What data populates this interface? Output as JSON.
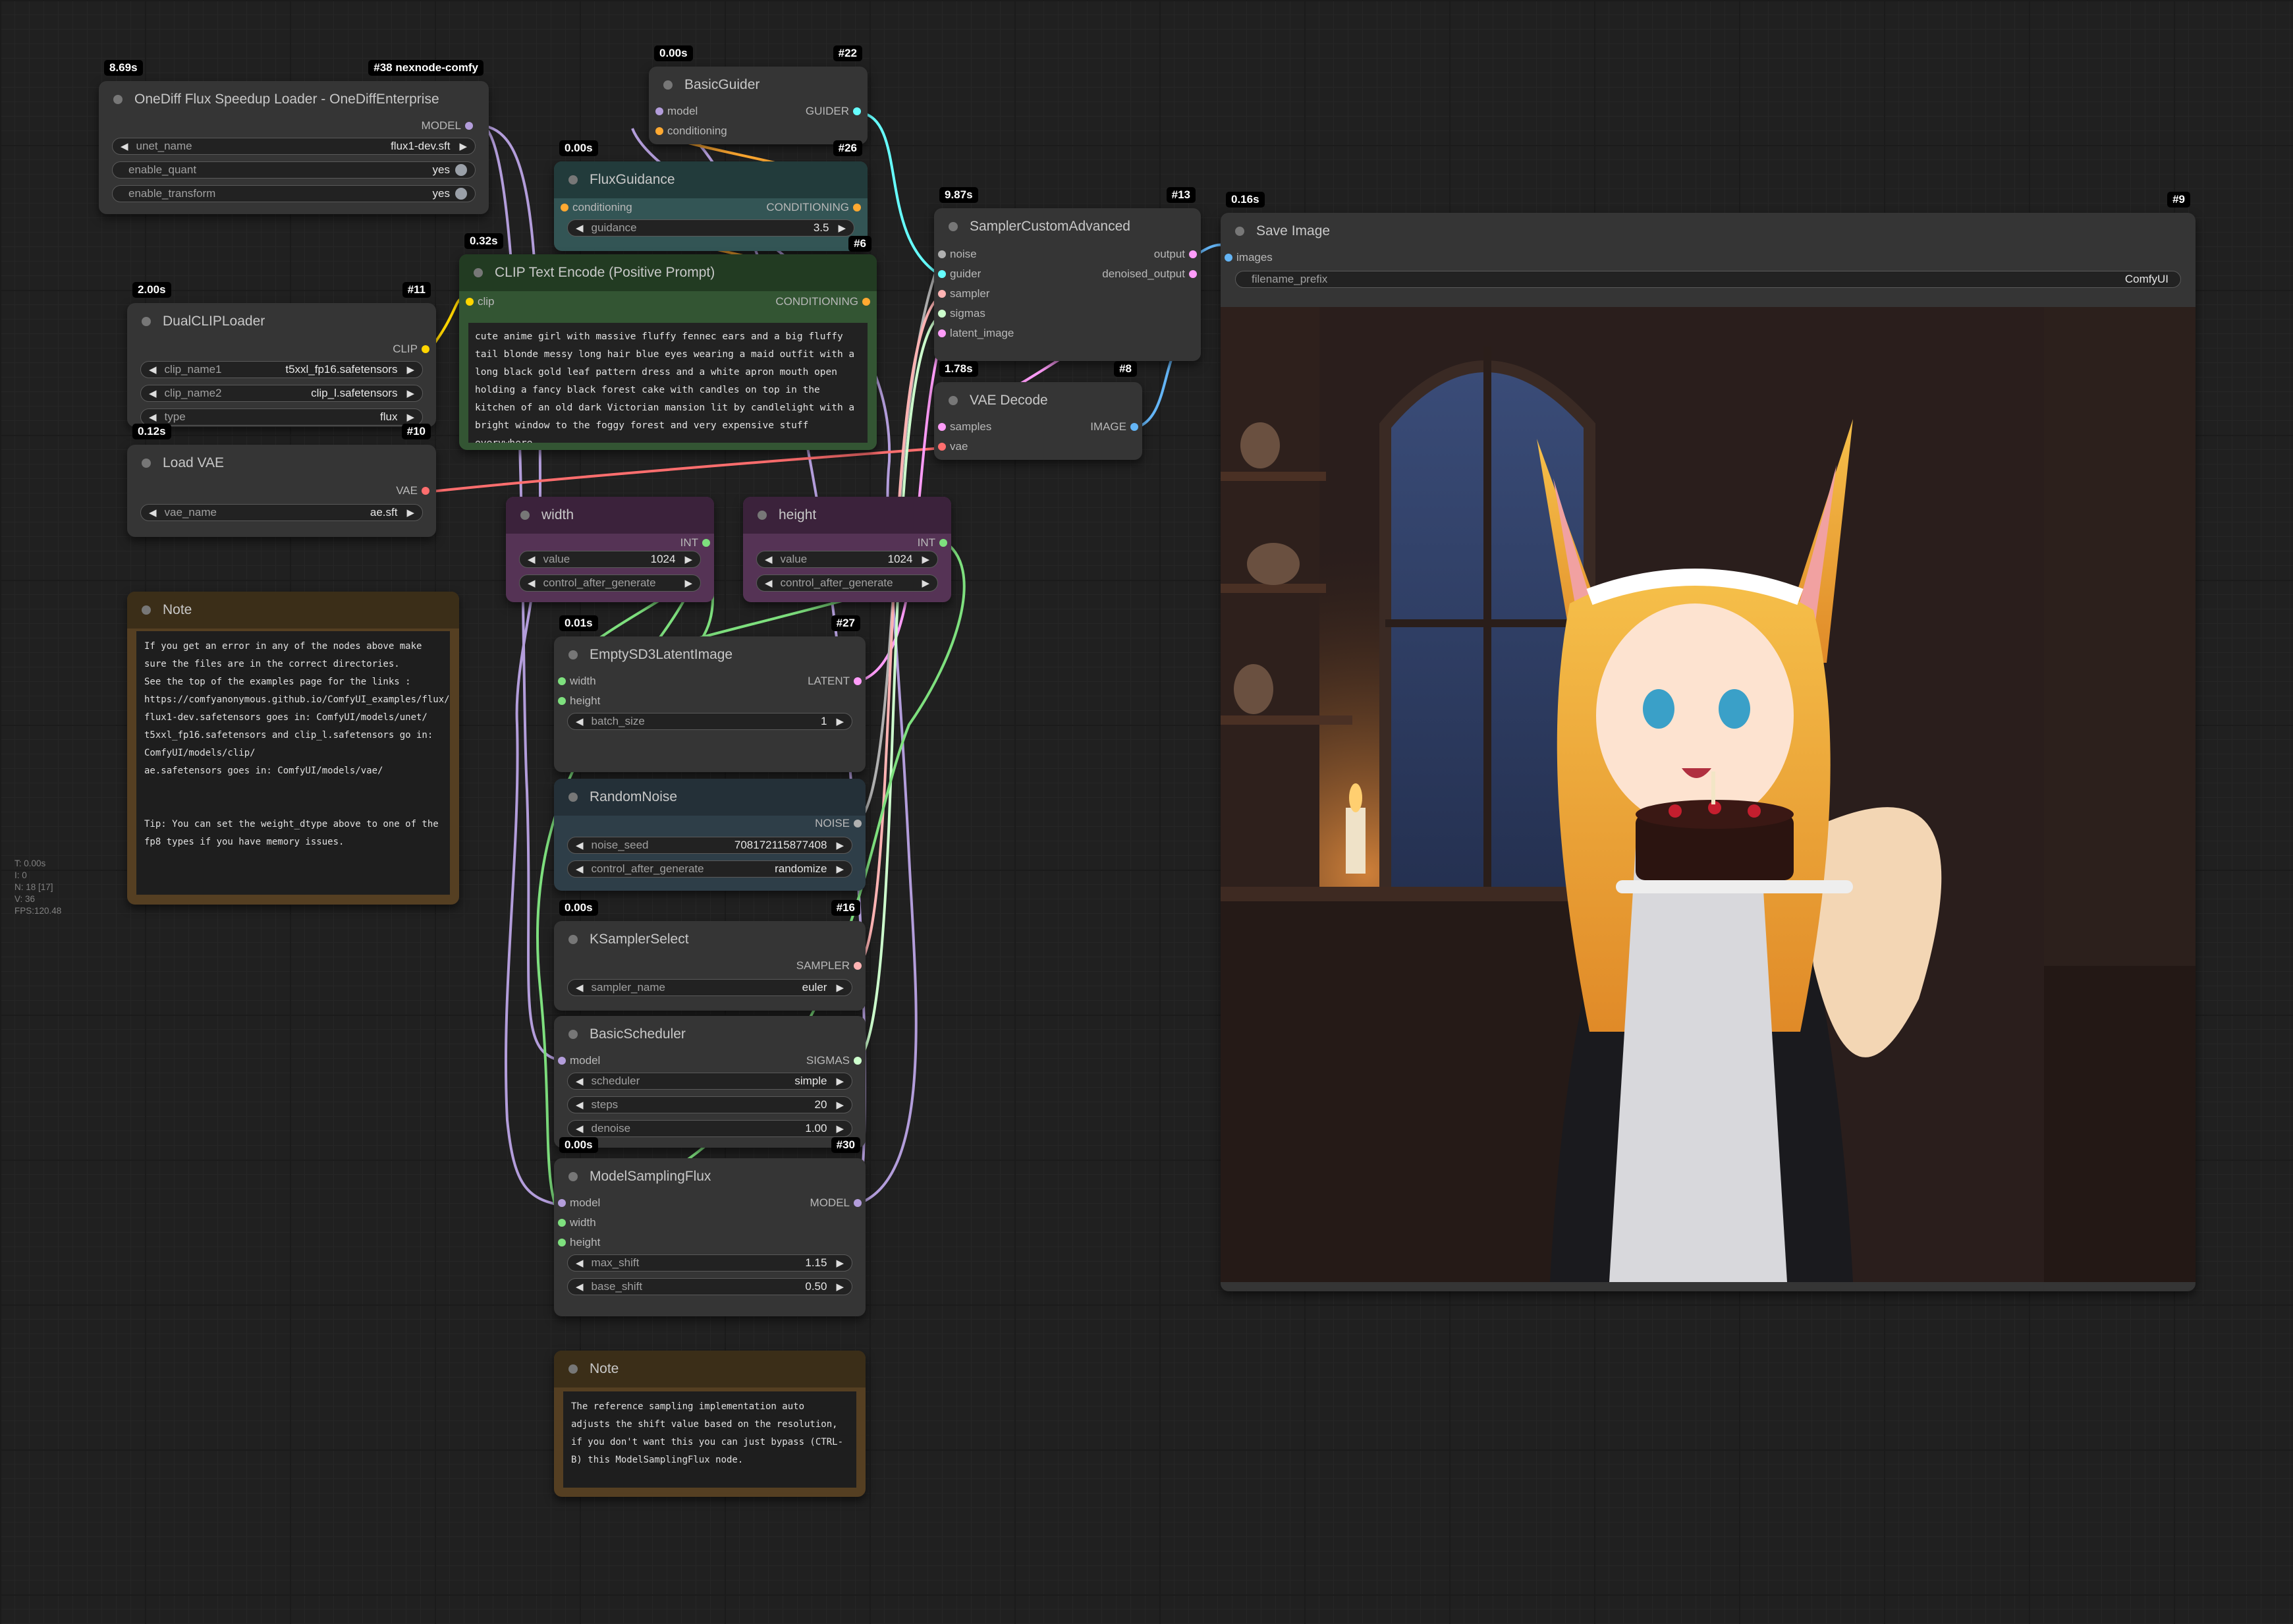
{
  "app": {
    "name": "ComfyUI"
  },
  "colors": {
    "model": "#b39ddb",
    "conditioning": "#ffa931",
    "clip": "#ffd500",
    "vae": "#ff6e6e",
    "latent": "#ff9cf9",
    "image": "#64b5f6",
    "int": "#7ee07e",
    "noise": "#b0b0b0",
    "guider": "#66ffff",
    "sampler": "#ffb3b3",
    "sigmas": "#cdffcd"
  },
  "stats": [
    "T: 0.00s",
    "I: 0",
    "N: 18 [17]",
    "V: 36",
    "FPS:120.48"
  ],
  "nodes": {
    "onediff": {
      "time": "8.69s",
      "id": "#38 nexnode-comfy",
      "title": "OneDiff Flux Speedup Loader - OneDiffEnterprise",
      "out_model": "MODEL",
      "w1": {
        "label": "unet_name",
        "value": "flux1-dev.sft"
      },
      "w2": {
        "label": "enable_quant",
        "value": "yes"
      },
      "w3": {
        "label": "enable_transform",
        "value": "yes"
      }
    },
    "basicguider": {
      "time": "0.00s",
      "id": "#22",
      "title": "BasicGuider",
      "in_model": "model",
      "in_cond": "conditioning",
      "out": "GUIDER"
    },
    "fluxguidance": {
      "time": "0.00s",
      "id": "#26",
      "title": "FluxGuidance",
      "in_cond": "conditioning",
      "out": "CONDITIONING",
      "w1": {
        "label": "guidance",
        "value": "3.5"
      }
    },
    "clipencode": {
      "time": "0.32s",
      "id": "#6",
      "title": "CLIP Text Encode (Positive Prompt)",
      "in_clip": "clip",
      "out": "CONDITIONING",
      "text": "cute anime girl with massive fluffy fennec ears and a big fluffy tail blonde messy long hair blue eyes wearing a maid outfit with a long black gold leaf pattern dress and a white apron mouth open holding a fancy black forest cake with candles on top in the kitchen of an old dark Victorian mansion lit by candlelight with a bright window to the foggy forest and very expensive stuff everywhere"
    },
    "dualclip": {
      "time": "2.00s",
      "id": "#11",
      "title": "DualCLIPLoader",
      "out": "CLIP",
      "w1": {
        "label": "clip_name1",
        "value": "t5xxl_fp16.safetensors"
      },
      "w2": {
        "label": "clip_name2",
        "value": "clip_l.safetensors"
      },
      "w3": {
        "label": "type",
        "value": "flux"
      }
    },
    "loadvae": {
      "time": "0.12s",
      "id": "#10",
      "title": "Load VAE",
      "out": "VAE",
      "w1": {
        "label": "vae_name",
        "value": "ae.sft"
      }
    },
    "sampler": {
      "time": "9.87s",
      "id": "#13",
      "title": "SamplerCustomAdvanced",
      "in_noise": "noise",
      "in_guider": "guider",
      "in_sampler": "sampler",
      "in_sigmas": "sigmas",
      "in_latent": "latent_image",
      "out1": "output",
      "out2": "denoised_output"
    },
    "vaedecode": {
      "time": "1.78s",
      "id": "#8",
      "title": "VAE Decode",
      "in_samples": "samples",
      "in_vae": "vae",
      "out": "IMAGE"
    },
    "saveimage": {
      "time": "0.16s",
      "id": "#9",
      "title": "Save Image",
      "in_images": "images",
      "w1": {
        "label": "filename_prefix",
        "value": "ComfyUI"
      }
    },
    "width": {
      "title": "width",
      "out": "INT",
      "w1": {
        "label": "value",
        "value": "1024"
      },
      "w2": {
        "label": "control_after_generate",
        "value": ""
      }
    },
    "height": {
      "title": "height",
      "out": "INT",
      "w1": {
        "label": "value",
        "value": "1024"
      },
      "w2": {
        "label": "control_after_generate",
        "value": ""
      }
    },
    "note1": {
      "title": "Note",
      "text": "If you get an error in any of the nodes above make sure the files are in the correct directories.\nSee the top of the examples page for the links : https://comfyanonymous.github.io/ComfyUI_examples/flux/\nflux1-dev.safetensors goes in: ComfyUI/models/unet/\nt5xxl_fp16.safetensors and clip_l.safetensors go in: ComfyUI/models/clip/\nae.safetensors goes in: ComfyUI/models/vae/\n\n\nTip: You can set the weight_dtype above to one of the fp8 types if you have memory issues."
    },
    "empty": {
      "time": "0.01s",
      "id": "#27",
      "title": "EmptySD3LatentImage",
      "in_width": "width",
      "in_height": "height",
      "out": "LATENT",
      "w1": {
        "label": "batch_size",
        "value": "1"
      }
    },
    "randomnoise": {
      "title": "RandomNoise",
      "out": "NOISE",
      "w1": {
        "label": "noise_seed",
        "value": "708172115877408"
      },
      "w2": {
        "label": "control_after_generate",
        "value": "randomize"
      }
    },
    "ksamplerselect": {
      "time": "0.00s",
      "id": "#16",
      "title": "KSamplerSelect",
      "out": "SAMPLER",
      "w1": {
        "label": "sampler_name",
        "value": "euler"
      }
    },
    "scheduler": {
      "title": "BasicScheduler",
      "in_model": "model",
      "out": "SIGMAS",
      "w1": {
        "label": "scheduler",
        "value": "simple"
      },
      "w2": {
        "label": "steps",
        "value": "20"
      },
      "w3": {
        "label": "denoise",
        "value": "1.00"
      }
    },
    "modelsampling": {
      "time": "0.00s",
      "id": "#30",
      "title": "ModelSamplingFlux",
      "in_model": "model",
      "in_width": "width",
      "in_height": "height",
      "out": "MODEL",
      "w1": {
        "label": "max_shift",
        "value": "1.15"
      },
      "w2": {
        "label": "base_shift",
        "value": "0.50"
      }
    },
    "note2": {
      "title": "Note",
      "text": "The reference sampling implementation auto adjusts the shift value based on the resolution, if you don't want this you can just bypass (CTRL-B) this ModelSamplingFlux node."
    }
  }
}
